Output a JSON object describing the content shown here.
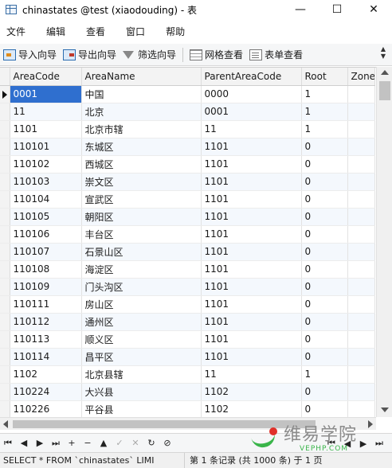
{
  "window": {
    "title": "chinastates @test (xiaodouding) - 表",
    "minimize": "—",
    "maximize": "☐",
    "close": "✕"
  },
  "menu": [
    "文件",
    "编辑",
    "查看",
    "窗口",
    "帮助"
  ],
  "toolbar": {
    "import": "导入向导",
    "export": "导出向导",
    "filter": "筛选向导",
    "grid_view": "网格查看",
    "form_view": "表单查看"
  },
  "table": {
    "columns": [
      "AreaCode",
      "AreaName",
      "ParentAreaCode",
      "Root",
      "Zone"
    ],
    "rows": [
      [
        "0001",
        "中国",
        "0000",
        "1",
        ""
      ],
      [
        "11",
        "北京",
        "0001",
        "1",
        ""
      ],
      [
        "1101",
        "北京市辖",
        "11",
        "1",
        ""
      ],
      [
        "110101",
        "东城区",
        "1101",
        "0",
        ""
      ],
      [
        "110102",
        "西城区",
        "1101",
        "0",
        ""
      ],
      [
        "110103",
        "崇文区",
        "1101",
        "0",
        ""
      ],
      [
        "110104",
        "宣武区",
        "1101",
        "0",
        ""
      ],
      [
        "110105",
        "朝阳区",
        "1101",
        "0",
        ""
      ],
      [
        "110106",
        "丰台区",
        "1101",
        "0",
        ""
      ],
      [
        "110107",
        "石景山区",
        "1101",
        "0",
        ""
      ],
      [
        "110108",
        "海淀区",
        "1101",
        "0",
        ""
      ],
      [
        "110109",
        "门头沟区",
        "1101",
        "0",
        ""
      ],
      [
        "110111",
        "房山区",
        "1101",
        "0",
        ""
      ],
      [
        "110112",
        "通州区",
        "1101",
        "0",
        ""
      ],
      [
        "110113",
        "顺义区",
        "1101",
        "0",
        ""
      ],
      [
        "110114",
        "昌平区",
        "1101",
        "0",
        ""
      ],
      [
        "1102",
        "北京县辖",
        "11",
        "1",
        ""
      ],
      [
        "110224",
        "大兴县",
        "1102",
        "0",
        ""
      ],
      [
        "110226",
        "平谷县",
        "1102",
        "0",
        ""
      ]
    ]
  },
  "nav": {
    "first": "⏮",
    "prev": "◀",
    "next": "▶",
    "last": "⏭",
    "add": "+",
    "delete": "−",
    "up": "▲",
    "apply": "✓",
    "cancel": "✕",
    "refresh": "↻",
    "stop": "⊘"
  },
  "watermark": {
    "main": "维易学院",
    "sub": "VEPHP.COM"
  },
  "status": {
    "sql": "SELECT * FROM `chinastates` LIMI",
    "records": "第 1 条记录 (共 1000 条) 于 1 页"
  }
}
